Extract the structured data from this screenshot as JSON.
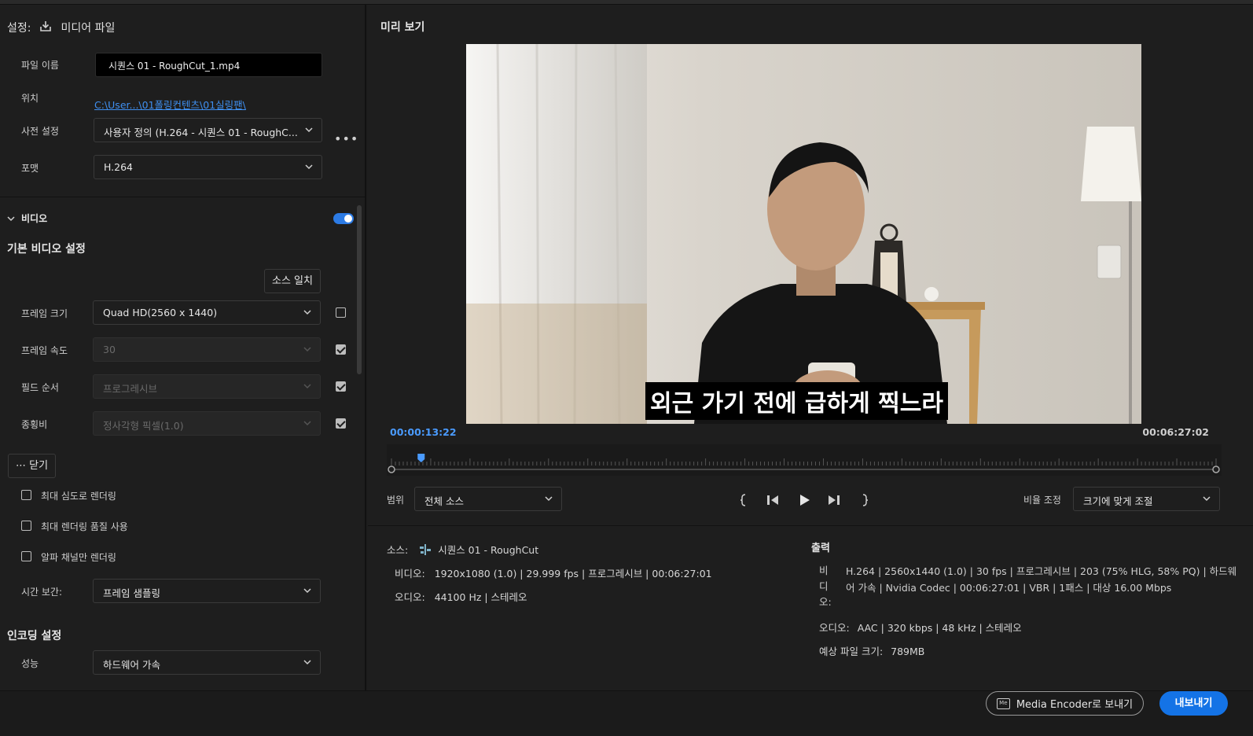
{
  "settings": {
    "label": "설정:",
    "media_file": "미디어 파일",
    "file_name_label": "파일 이름",
    "file_name": "시퀀스 01 - RoughCut_1.mp4",
    "location_label": "위치",
    "location": "C:\\User...\\01폴링컨텐츠\\01실링팬\\",
    "preset_label": "사전 설정",
    "preset": "사용자 정의 (H.264 - 시퀀스 01 - RoughC...",
    "format_label": "포맷",
    "format": "H.264"
  },
  "video_section": {
    "title": "비디오",
    "enabled": true,
    "basic_title": "기본 비디오 설정",
    "match_source": "소스 일치",
    "frame_size_label": "프레임 크기",
    "frame_size": "Quad HD(2560 x 1440)",
    "frame_rate_label": "프레임 속도",
    "frame_rate": "30",
    "field_order_label": "필드 순서",
    "field_order": "프로그레시브",
    "aspect_label": "종횡비",
    "aspect": "정사각형 픽셀(1.0)",
    "close_label": "닫기",
    "opt_max_depth": "최대 심도로 렌더링",
    "opt_max_quality": "최대 렌더링 품질 사용",
    "opt_alpha_only": "알파 채널만 렌더링",
    "time_interp_label": "시간 보간:",
    "time_interp": "프레임 샘플링",
    "encoding_title": "인코딩 설정",
    "performance_label": "성능",
    "performance": "하드웨어 가속"
  },
  "preview": {
    "title": "미리 보기",
    "subtitle": "외근 가기 전에 급하게 찍느라",
    "current_time": "00:00:13:22",
    "duration": "00:06:27:02",
    "playhead_fraction": 0.036,
    "range_label": "범위",
    "range": "전체 소스",
    "scale_label": "비율 조정",
    "scale": "크기에 맞게 조절"
  },
  "source_info": {
    "source_label": "소스:",
    "source_name": "시퀀스 01 - RoughCut",
    "video_label": "비디오:",
    "video": "1920x1080 (1.0)  |  29.999 fps  |  프로그레시브  |  00:06:27:01",
    "audio_label": "오디오:",
    "audio": "44100 Hz  |  스테레오"
  },
  "output_info": {
    "title": "출력",
    "video_label_1": "비",
    "video_label_2": "디",
    "video_label_3": "오:",
    "video_line1": "H.264  |  2560x1440 (1.0)  |  30 fps  |  프로그레시브  |  203 (75% HLG, 58% PQ)  |  하드웨",
    "video_line2": "어 가속  |  Nvidia Codec  |  00:06:27:01  |  VBR  |  1패스  |  대상 16.00 Mbps",
    "audio_label": "오디오:",
    "audio": "AAC  |  320 kbps  |  48 kHz  |  스테레오",
    "size_label": "예상 파일 크기:",
    "size": "789MB"
  },
  "footer": {
    "encoder_icon": "Me",
    "encoder": "Media Encoder로 보내기",
    "export": "내보내기"
  },
  "colors": {
    "accent": "#1473e6",
    "link": "#3f8ff0",
    "timecode": "#4a9bff"
  }
}
